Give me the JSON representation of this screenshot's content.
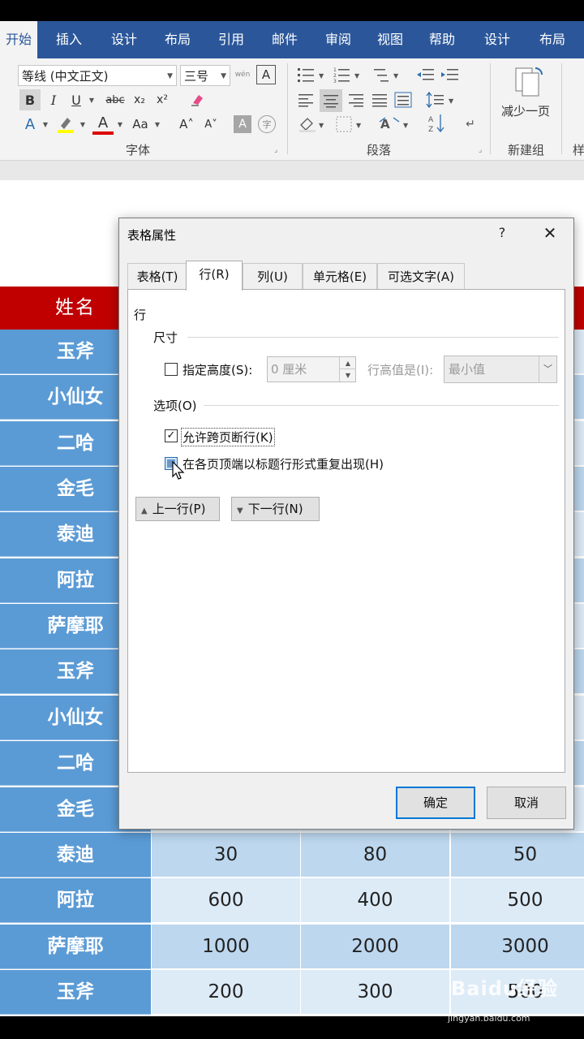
{
  "ribbon": {
    "tabs": [
      "开始",
      "插入",
      "设计",
      "布局",
      "引用",
      "邮件",
      "审阅",
      "视图",
      "帮助",
      "设计",
      "布局"
    ],
    "font_name": "等线 (中文正文)",
    "font_size": "三号",
    "phonetic_glyph": "wén",
    "border_glyph": "A",
    "bold": "B",
    "italic": "I",
    "underline": "U",
    "strike": "abc",
    "subscript": "x₂",
    "superscript": "x²",
    "text_effect": "A",
    "font_color": "A",
    "change_case": "Aa",
    "grow_font": "A˄",
    "shrink_font": "A˅",
    "char_shading": "A",
    "enclose_char": "字",
    "font_group_label": "字体",
    "paragraph_group_label": "段落",
    "page_btn_label": "减少一页",
    "new_group_label": "新建组",
    "next_group_partial": "样",
    "accent_color": "#2b579a"
  },
  "table": {
    "header_name": "姓名",
    "rows": [
      {
        "name": "玉斧",
        "values": [
          "",
          "",
          ""
        ]
      },
      {
        "name": "小仙女",
        "values": [
          "",
          "",
          ""
        ]
      },
      {
        "name": "二哈",
        "values": [
          "",
          "",
          ""
        ]
      },
      {
        "name": "金毛",
        "values": [
          "",
          "",
          ""
        ]
      },
      {
        "name": "泰迪",
        "values": [
          "",
          "",
          ""
        ]
      },
      {
        "name": "阿拉",
        "values": [
          "",
          "",
          ""
        ]
      },
      {
        "name": "萨摩耶",
        "values": [
          "",
          "",
          ""
        ]
      },
      {
        "name": "玉斧",
        "values": [
          "",
          "",
          ""
        ]
      },
      {
        "name": "小仙女",
        "values": [
          "",
          "",
          ""
        ]
      },
      {
        "name": "二哈",
        "values": [
          "",
          "",
          ""
        ]
      },
      {
        "name": "金毛",
        "values": [
          "",
          "",
          ""
        ]
      },
      {
        "name": "泰迪",
        "values": [
          "30",
          "80",
          "50"
        ]
      },
      {
        "name": "阿拉",
        "values": [
          "600",
          "400",
          "500"
        ]
      },
      {
        "name": "萨摩耶",
        "values": [
          "1000",
          "2000",
          "3000"
        ]
      },
      {
        "name": "玉斧",
        "values": [
          "200",
          "300",
          "500"
        ]
      }
    ],
    "header_color": "#c00000",
    "name_cell_color": "#5b9bd5"
  },
  "dialog": {
    "title": "表格属性",
    "help": "?",
    "close": "✕",
    "tabs": [
      "表格(T)",
      "行(R)",
      "列(U)",
      "单元格(E)",
      "可选文字(A)"
    ],
    "active_tab": "行(R)",
    "section_title": "行",
    "size_group": "尺寸",
    "specify_height_label": "指定高度(S):",
    "height_value": "0 厘米",
    "row_height_is_label": "行高值是(I):",
    "row_height_mode": "最小值",
    "options_group": "选项(O)",
    "allow_break_label": "允许跨页断行(K)",
    "allow_break_checked": true,
    "repeat_header_label": "在各页顶端以标题行形式重复出现(H)",
    "repeat_header_checked": false,
    "prev_row_label": "上一行(P)",
    "next_row_label": "下一行(N)",
    "ok_label": "确定",
    "cancel_label": "取消"
  },
  "watermark": {
    "brand": "Baidu经验",
    "url": "jingyan.baidu.com"
  }
}
